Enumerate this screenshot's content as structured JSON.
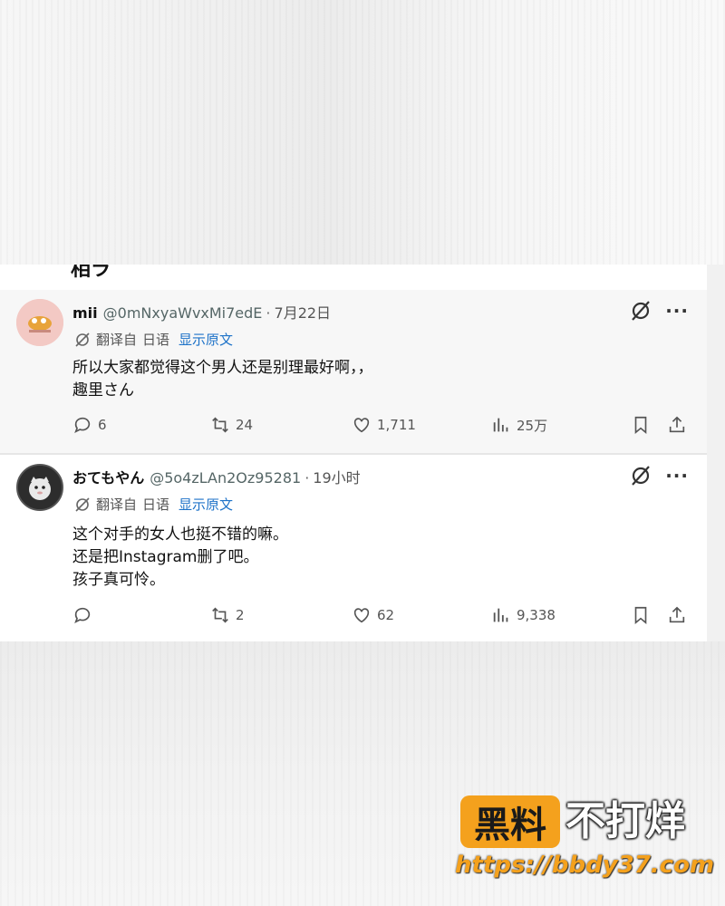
{
  "prev_tweet_fragment": "相ラ",
  "tweets": [
    {
      "name": "mii",
      "handle": "@0mNxyaWvxMi7edE",
      "time": "7月22日",
      "translate": {
        "label": "翻译自",
        "lang": "日语",
        "show_original": "显示原文"
      },
      "lines": [
        "所以大家都觉得这个男人还是别理最好啊，，",
        "趣里さん"
      ],
      "reply_count": "6",
      "retweet_count": "24",
      "like_count": "1,711",
      "views": "25万"
    },
    {
      "name": "おてもやん",
      "handle": "@5o4zLAn2Oz95281",
      "time": "19小时",
      "translate": {
        "label": "翻译自",
        "lang": "日语",
        "show_original": "显示原文"
      },
      "lines": [
        "这个对手的女人也挺不错的嘛。",
        "还是把Instagram删了吧。",
        "孩子真可怜。"
      ],
      "reply_count": "",
      "retweet_count": "2",
      "like_count": "62",
      "views": "9,338"
    }
  ],
  "watermark": {
    "badge": "黑料",
    "title": "不打烊",
    "url": "https://bbdy37.com"
  },
  "colors": {
    "link": "#1d72c8",
    "watermark_orange": "#f4a11d"
  }
}
